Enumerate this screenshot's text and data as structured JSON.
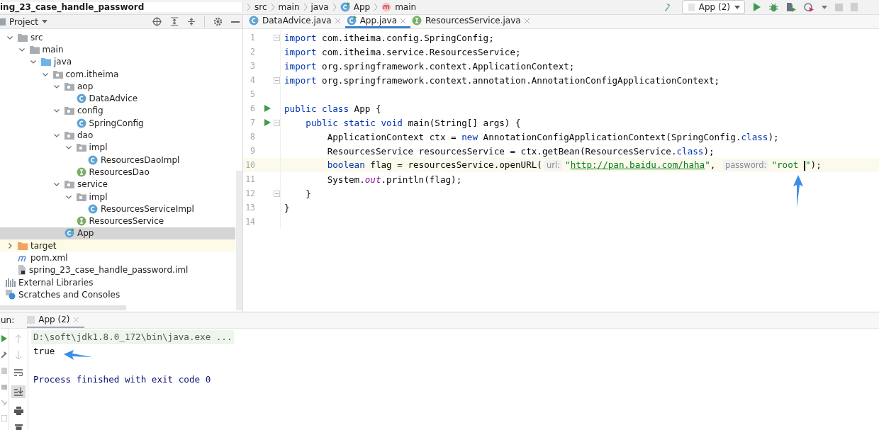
{
  "breadcrumb": [
    {
      "label": "ing_23_case_handle_password",
      "kind": "project"
    },
    {
      "label": "src",
      "kind": "folder"
    },
    {
      "label": "main",
      "kind": "folder"
    },
    {
      "label": "java",
      "kind": "folder"
    },
    {
      "label": "App",
      "kind": "class"
    },
    {
      "label": "main",
      "kind": "method"
    }
  ],
  "run_config": {
    "label": "App (2)"
  },
  "project_panel": {
    "title": "Project"
  },
  "tree": [
    {
      "label": "src",
      "kind": "folder",
      "expanded": true,
      "children": [
        {
          "label": "main",
          "kind": "folder",
          "expanded": true,
          "children": [
            {
              "label": "java",
              "kind": "source-folder",
              "expanded": true,
              "children": [
                {
                  "label": "com.itheima",
                  "kind": "package",
                  "expanded": true,
                  "children": [
                    {
                      "label": "aop",
                      "kind": "package",
                      "expanded": true,
                      "children": [
                        {
                          "label": "DataAdvice",
                          "kind": "class",
                          "selected": false
                        }
                      ]
                    },
                    {
                      "label": "config",
                      "kind": "package",
                      "expanded": true,
                      "children": [
                        {
                          "label": "SpringConfig",
                          "kind": "class",
                          "selected": false
                        }
                      ]
                    },
                    {
                      "label": "dao",
                      "kind": "package",
                      "expanded": true,
                      "children": [
                        {
                          "label": "impl",
                          "kind": "package",
                          "expanded": true,
                          "children": [
                            {
                              "label": "ResourcesDaoImpl",
                              "kind": "class",
                              "selected": false
                            }
                          ]
                        },
                        {
                          "label": "ResourcesDao",
                          "kind": "interface",
                          "selected": false
                        }
                      ]
                    },
                    {
                      "label": "service",
                      "kind": "package",
                      "expanded": true,
                      "children": [
                        {
                          "label": "impl",
                          "kind": "package",
                          "expanded": true,
                          "children": [
                            {
                              "label": "ResourcesServiceImpl",
                              "kind": "class",
                              "selected": false
                            }
                          ]
                        },
                        {
                          "label": "ResourcesService",
                          "kind": "interface",
                          "selected": false
                        }
                      ]
                    },
                    {
                      "label": "App",
                      "kind": "main-class",
                      "selected": true
                    }
                  ]
                }
              ]
            }
          ]
        }
      ]
    },
    {
      "label": "target",
      "kind": "excluded-folder",
      "expanded": false
    },
    {
      "label": "pom.xml",
      "kind": "maven"
    },
    {
      "label": "spring_23_case_handle_password.iml",
      "kind": "module-file"
    }
  ],
  "tree_extras": [
    {
      "label": "External Libraries",
      "kind": "libraries"
    },
    {
      "label": "Scratches and Consoles",
      "kind": "scratches"
    }
  ],
  "editor_tabs": [
    {
      "label": "DataAdvice.java",
      "kind": "class",
      "selected": false
    },
    {
      "label": "App.java",
      "kind": "main-class",
      "selected": true
    },
    {
      "label": "ResourcesService.java",
      "kind": "interface",
      "selected": false
    }
  ],
  "code_lines": [
    {
      "number": "1",
      "current": false,
      "run": false,
      "fold": true,
      "tokens": [
        {
          "text": "import",
          "kind": "keyword"
        },
        {
          "text": " com.itheima.config.SpringConfig;",
          "kind": "plain"
        }
      ]
    },
    {
      "number": "2",
      "current": false,
      "run": false,
      "fold": false,
      "tokens": [
        {
          "text": "import",
          "kind": "keyword"
        },
        {
          "text": " com.itheima.service.ResourcesService;",
          "kind": "plain"
        }
      ]
    },
    {
      "number": "3",
      "current": false,
      "run": false,
      "fold": false,
      "tokens": [
        {
          "text": "import",
          "kind": "keyword"
        },
        {
          "text": " org.springframework.context.ApplicationContext;",
          "kind": "plain"
        }
      ]
    },
    {
      "number": "4",
      "current": false,
      "run": false,
      "fold": true,
      "tokens": [
        {
          "text": "import",
          "kind": "keyword"
        },
        {
          "text": " org.springframework.context.annotation.AnnotationConfigApplicationContext;",
          "kind": "plain"
        }
      ]
    },
    {
      "number": "5",
      "current": false,
      "run": false,
      "fold": false
    },
    {
      "number": "6",
      "current": false,
      "run": true,
      "fold": false,
      "tokens": [
        {
          "text": "public class",
          "kind": "keyword"
        },
        {
          "text": " App {",
          "kind": "plain"
        }
      ]
    },
    {
      "number": "7",
      "current": false,
      "run": true,
      "fold": true,
      "tokens": [
        {
          "text": "    public static void",
          "kind": "keyword"
        },
        {
          "text": " main(String[] args) {",
          "kind": "plain"
        }
      ]
    },
    {
      "number": "8",
      "current": false,
      "run": false,
      "fold": false,
      "tokens": [
        {
          "text": "        ApplicationContext ctx = ",
          "kind": "plain"
        },
        {
          "text": "new",
          "kind": "keyword"
        },
        {
          "text": " AnnotationConfigApplicationContext(SpringConfig.",
          "kind": "plain"
        },
        {
          "text": "class",
          "kind": "keyword"
        },
        {
          "text": ");",
          "kind": "plain"
        }
      ]
    },
    {
      "number": "9",
      "current": false,
      "run": false,
      "fold": false,
      "tokens": [
        {
          "text": "        ResourcesService resourcesService = ctx.getBean(ResourcesService.",
          "kind": "plain"
        },
        {
          "text": "class",
          "kind": "keyword"
        },
        {
          "text": ");",
          "kind": "plain"
        }
      ]
    },
    {
      "number": "10",
      "current": true,
      "run": false,
      "fold": false,
      "tokens": [
        {
          "text": "        boolean",
          "kind": "keyword"
        },
        {
          "text": " flag = resourcesService.openURL(",
          "kind": "plain"
        },
        {
          "text": "url:",
          "kind": "hint"
        },
        {
          "text": "\"",
          "kind": "string"
        },
        {
          "text": "http://pan.baidu.com/haha",
          "kind": "url"
        },
        {
          "text": "\"",
          "kind": "string"
        },
        {
          "text": ", ",
          "kind": "plain"
        },
        {
          "text": "password:",
          "kind": "hint"
        },
        {
          "text": "\"root ",
          "kind": "string"
        },
        {
          "kind": "cursor"
        },
        {
          "text": "\"",
          "kind": "string"
        },
        {
          "text": ");",
          "kind": "plain"
        }
      ]
    },
    {
      "number": "11",
      "current": false,
      "run": false,
      "fold": false,
      "tokens": [
        {
          "text": "        System.",
          "kind": "plain"
        },
        {
          "text": "out",
          "kind": "static"
        },
        {
          "text": ".println(flag);",
          "kind": "plain"
        }
      ]
    },
    {
      "number": "12",
      "current": false,
      "run": false,
      "fold": true,
      "tokens": [
        {
          "text": "    }",
          "kind": "plain"
        }
      ]
    },
    {
      "number": "13",
      "current": false,
      "run": false,
      "fold": false,
      "tokens": [
        {
          "text": "}",
          "kind": "plain"
        }
      ]
    },
    {
      "number": "14",
      "current": false,
      "run": false,
      "fold": false
    }
  ],
  "run_panel": {
    "label": "un:",
    "tab": "App (2)",
    "lines": [
      {
        "kind": "command",
        "text": "D:\\soft\\jdk1.8.0_172\\bin\\java.exe ..."
      },
      {
        "kind": "output",
        "text": "true"
      },
      {
        "kind": "blank"
      },
      {
        "kind": "system",
        "text": "Process finished with exit code 0"
      }
    ]
  }
}
